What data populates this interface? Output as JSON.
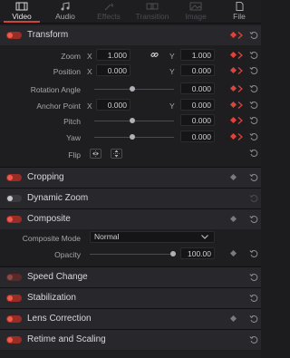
{
  "tabs": [
    {
      "label": "Video",
      "icon": "video-icon",
      "state": "active"
    },
    {
      "label": "Audio",
      "icon": "audio-icon",
      "state": "normal"
    },
    {
      "label": "Effects",
      "icon": "effects-icon",
      "state": "disabled"
    },
    {
      "label": "Transition",
      "icon": "transition-icon",
      "state": "disabled"
    },
    {
      "label": "Image",
      "icon": "image-icon",
      "state": "disabled"
    },
    {
      "label": "File",
      "icon": "file-icon",
      "state": "normal"
    }
  ],
  "transform": {
    "title": "Transform",
    "zoom": {
      "label": "Zoom",
      "x_axis": "X",
      "x": "1.000",
      "y_axis": "Y",
      "y": "1.000"
    },
    "position": {
      "label": "Position",
      "x_axis": "X",
      "x": "0.000",
      "y_axis": "Y",
      "y": "0.000"
    },
    "rotation": {
      "label": "Rotation Angle",
      "value": "0.000"
    },
    "anchor": {
      "label": "Anchor Point",
      "x_axis": "X",
      "x": "0.000",
      "y_axis": "Y",
      "y": "0.000"
    },
    "pitch": {
      "label": "Pitch",
      "value": "0.000"
    },
    "yaw": {
      "label": "Yaw",
      "value": "0.000"
    },
    "flip": {
      "label": "Flip"
    }
  },
  "cropping": {
    "title": "Cropping"
  },
  "dynamic_zoom": {
    "title": "Dynamic Zoom"
  },
  "composite": {
    "title": "Composite",
    "mode_label": "Composite Mode",
    "mode_value": "Normal",
    "opacity_label": "Opacity",
    "opacity_value": "100.00"
  },
  "speed_change": {
    "title": "Speed Change"
  },
  "stabilization": {
    "title": "Stabilization"
  },
  "lens_correction": {
    "title": "Lens Correction"
  },
  "retime": {
    "title": "Retime and Scaling"
  },
  "colors": {
    "accent": "#e0433a",
    "panel": "#1e1e21",
    "header": "#28282c"
  }
}
